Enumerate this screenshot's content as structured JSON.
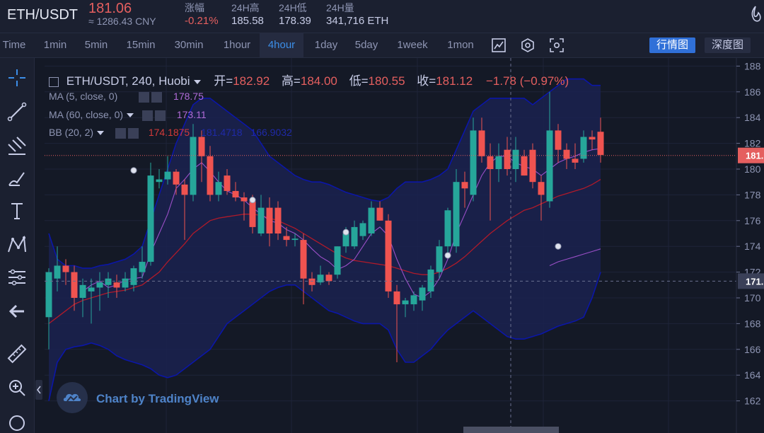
{
  "ticker": {
    "pair": "ETH/USDT",
    "price": "181.06",
    "cny": "≈ 1286.43 CNY",
    "change_label": "涨幅",
    "change_value": "-0.21%",
    "high_label": "24H高",
    "high_value": "185.58",
    "low_label": "24H低",
    "low_value": "178.39",
    "volume_label": "24H量",
    "volume_value": "341,716 ETH"
  },
  "toolbar": {
    "intervals": [
      "Time",
      "1min",
      "5min",
      "15min",
      "30min",
      "1hour",
      "4hour",
      "1day",
      "5day",
      "1week",
      "1mon"
    ],
    "active_interval": "4hour",
    "mode_buttons": [
      "行情图",
      "深度图"
    ],
    "active_mode": "行情图"
  },
  "legend": {
    "main": {
      "title": "ETH/USDT, 240, Huobi",
      "open_label": "开=",
      "open": "182.92",
      "high_label": "高=",
      "high": "184.00",
      "low_label": "低=",
      "low": "180.55",
      "close_label": "收=",
      "close": "181.12",
      "change": "−1.78 (−0.97%)"
    },
    "ma5": {
      "label": "MA (5, close, 0)",
      "value": "178.75",
      "color": "#b06bd8"
    },
    "ma60": {
      "label": "MA (60, close, 0)",
      "value": "173.11",
      "color": "#b06bd8"
    },
    "bb": {
      "label": "BB (20, 2)",
      "values": [
        "174.1875",
        "181.4718",
        "166.9032"
      ],
      "colors": [
        "#d23a3a",
        "#1f2aa8",
        "#1f2aa8"
      ]
    }
  },
  "watermark": {
    "text": "Chart by TradingView"
  },
  "colors": {
    "up": "#26a69a",
    "down": "#ef5350",
    "bg": "#141926",
    "band_fill": "#1a2250",
    "band_line": "#0b16a8",
    "mid_line": "#b01a2a",
    "ma_line": "#9a4fc7",
    "price_line": "#e55f5f"
  },
  "chart_data": {
    "type": "candlestick",
    "pair": "ETH/USDT",
    "interval": "240",
    "exchange": "Huobi",
    "ylim": [
      161,
      189
    ],
    "y_ticks": [
      162,
      164,
      166,
      168,
      170,
      172,
      174,
      176,
      178,
      180,
      182,
      184,
      186,
      188
    ],
    "last_price_tag": "181.",
    "crosshair_tag": "171.",
    "candles": [
      {
        "o": 168.5,
        "h": 172.3,
        "l": 166.0,
        "c": 172.0
      },
      {
        "o": 171.5,
        "h": 174.0,
        "l": 170.5,
        "c": 172.5
      },
      {
        "o": 172.5,
        "h": 173.0,
        "l": 171.0,
        "c": 172.0
      },
      {
        "o": 172.0,
        "h": 172.5,
        "l": 169.0,
        "c": 170.0
      },
      {
        "o": 170.0,
        "h": 171.5,
        "l": 168.5,
        "c": 171.0
      },
      {
        "o": 170.5,
        "h": 171.5,
        "l": 168.0,
        "c": 170.8
      },
      {
        "o": 170.8,
        "h": 172.0,
        "l": 169.0,
        "c": 171.2
      },
      {
        "o": 171.0,
        "h": 172.0,
        "l": 170.0,
        "c": 171.5
      },
      {
        "o": 171.2,
        "h": 171.8,
        "l": 170.0,
        "c": 170.8
      },
      {
        "o": 170.8,
        "h": 172.0,
        "l": 170.5,
        "c": 171.5
      },
      {
        "o": 171.0,
        "h": 172.5,
        "l": 170.5,
        "c": 172.3
      },
      {
        "o": 172.0,
        "h": 174.0,
        "l": 171.5,
        "c": 172.8
      },
      {
        "o": 172.8,
        "h": 180.5,
        "l": 172.5,
        "c": 179.5
      },
      {
        "o": 179.0,
        "h": 180.0,
        "l": 178.5,
        "c": 179.2
      },
      {
        "o": 179.2,
        "h": 181.0,
        "l": 178.8,
        "c": 179.8
      },
      {
        "o": 179.8,
        "h": 180.0,
        "l": 178.0,
        "c": 178.8
      },
      {
        "o": 178.8,
        "h": 179.2,
        "l": 174.5,
        "c": 178.0
      },
      {
        "o": 178.0,
        "h": 183.5,
        "l": 177.5,
        "c": 182.5
      },
      {
        "o": 182.5,
        "h": 183.0,
        "l": 179.0,
        "c": 181.0
      },
      {
        "o": 181.0,
        "h": 181.8,
        "l": 177.5,
        "c": 178.0
      },
      {
        "o": 178.0,
        "h": 179.8,
        "l": 177.5,
        "c": 179.0
      },
      {
        "o": 179.5,
        "h": 180.0,
        "l": 178.0,
        "c": 178.3
      },
      {
        "o": 178.3,
        "h": 179.0,
        "l": 177.5,
        "c": 177.8
      },
      {
        "o": 177.8,
        "h": 178.2,
        "l": 176.0,
        "c": 177.5
      },
      {
        "o": 177.5,
        "h": 178.0,
        "l": 175.0,
        "c": 175.5
      },
      {
        "o": 175.0,
        "h": 178.0,
        "l": 174.8,
        "c": 177.0
      },
      {
        "o": 177.0,
        "h": 177.8,
        "l": 174.0,
        "c": 175.0
      },
      {
        "o": 177.0,
        "h": 177.5,
        "l": 174.5,
        "c": 175.0
      },
      {
        "o": 174.8,
        "h": 175.5,
        "l": 174.0,
        "c": 174.5
      },
      {
        "o": 174.5,
        "h": 175.0,
        "l": 174.0,
        "c": 174.6
      },
      {
        "o": 174.5,
        "h": 175.0,
        "l": 169.5,
        "c": 171.5
      },
      {
        "o": 171.5,
        "h": 172.0,
        "l": 170.5,
        "c": 171.0
      },
      {
        "o": 171.2,
        "h": 172.5,
        "l": 171.0,
        "c": 171.8
      },
      {
        "o": 171.8,
        "h": 172.0,
        "l": 171.0,
        "c": 171.3
      },
      {
        "o": 171.8,
        "h": 174.0,
        "l": 171.5,
        "c": 174.0
      },
      {
        "o": 174.0,
        "h": 175.5,
        "l": 173.5,
        "c": 175.0
      },
      {
        "o": 174.0,
        "h": 176.0,
        "l": 173.8,
        "c": 175.5
      },
      {
        "o": 174.8,
        "h": 176.0,
        "l": 174.5,
        "c": 175.8
      },
      {
        "o": 175.0,
        "h": 177.5,
        "l": 174.8,
        "c": 177.0
      },
      {
        "o": 177.0,
        "h": 177.5,
        "l": 176.0,
        "c": 176.0
      },
      {
        "o": 176.0,
        "h": 176.5,
        "l": 170.0,
        "c": 170.5
      },
      {
        "o": 170.5,
        "h": 171.0,
        "l": 165.0,
        "c": 169.5
      },
      {
        "o": 169.5,
        "h": 170.0,
        "l": 168.5,
        "c": 169.8
      },
      {
        "o": 169.5,
        "h": 170.5,
        "l": 169.0,
        "c": 170.2
      },
      {
        "o": 169.8,
        "h": 171.0,
        "l": 169.0,
        "c": 170.8
      },
      {
        "o": 170.5,
        "h": 172.5,
        "l": 170.0,
        "c": 172.2
      },
      {
        "o": 172.0,
        "h": 174.5,
        "l": 171.5,
        "c": 174.0
      },
      {
        "o": 174.0,
        "h": 177.0,
        "l": 173.5,
        "c": 176.8
      },
      {
        "o": 174.0,
        "h": 180.0,
        "l": 173.5,
        "c": 179.0
      },
      {
        "o": 179.0,
        "h": 179.8,
        "l": 177.0,
        "c": 178.5
      },
      {
        "o": 178.0,
        "h": 184.0,
        "l": 177.5,
        "c": 183.0
      },
      {
        "o": 183.0,
        "h": 184.0,
        "l": 180.5,
        "c": 181.0
      },
      {
        "o": 181.0,
        "h": 182.0,
        "l": 176.0,
        "c": 180.0
      },
      {
        "o": 180.0,
        "h": 182.0,
        "l": 179.0,
        "c": 181.0
      },
      {
        "o": 181.5,
        "h": 182.5,
        "l": 179.5,
        "c": 180.0
      },
      {
        "o": 180.0,
        "h": 182.5,
        "l": 179.0,
        "c": 181.5
      },
      {
        "o": 181.0,
        "h": 181.5,
        "l": 179.5,
        "c": 179.5
      },
      {
        "o": 181.5,
        "h": 182.0,
        "l": 178.5,
        "c": 179.0
      },
      {
        "o": 179.0,
        "h": 179.5,
        "l": 176.0,
        "c": 178.0
      },
      {
        "o": 177.5,
        "h": 186.0,
        "l": 177.0,
        "c": 183.0
      },
      {
        "o": 183.0,
        "h": 183.5,
        "l": 180.5,
        "c": 181.5
      },
      {
        "o": 181.5,
        "h": 182.0,
        "l": 180.0,
        "c": 180.8
      },
      {
        "o": 180.8,
        "h": 182.0,
        "l": 180.0,
        "c": 180.5
      },
      {
        "o": 180.8,
        "h": 183.0,
        "l": 180.5,
        "c": 182.5
      },
      {
        "o": 182.5,
        "h": 183.0,
        "l": 181.5,
        "c": 182.3
      },
      {
        "o": 182.9,
        "h": 184.0,
        "l": 180.5,
        "c": 181.1
      }
    ],
    "ma5": [
      null,
      null,
      null,
      null,
      170.5,
      171.0,
      171.3,
      170.8,
      171.0,
      171.4,
      171.5,
      171.6,
      173.5,
      175.0,
      176.5,
      178.5,
      179.2,
      180.0,
      180.5,
      179.8,
      179.0,
      178.3,
      178.0,
      177.6,
      177.0,
      176.5,
      176.0,
      175.8,
      175.3,
      175.0,
      174.5,
      173.8,
      173.2,
      172.8,
      172.2,
      172.5,
      173.0,
      174.0,
      175.0,
      175.5,
      174.8,
      173.0,
      171.5,
      170.3,
      170.0,
      170.5,
      171.5,
      173.0,
      175.0,
      176.5,
      178.0,
      179.5,
      180.5,
      181.0,
      181.0,
      180.5,
      180.2,
      180.0,
      179.5,
      180.0,
      180.5,
      180.8,
      181.0,
      181.3,
      181.5,
      181.6
    ],
    "ma60": [
      null,
      null,
      null,
      null,
      null,
      null,
      null,
      null,
      null,
      null,
      null,
      null,
      null,
      null,
      null,
      null,
      null,
      null,
      null,
      null,
      null,
      null,
      null,
      null,
      null,
      null,
      null,
      null,
      null,
      null,
      null,
      null,
      null,
      null,
      null,
      null,
      null,
      null,
      null,
      null,
      null,
      null,
      null,
      null,
      null,
      null,
      null,
      null,
      null,
      null,
      null,
      null,
      null,
      null,
      null,
      null,
      null,
      null,
      null,
      172.5,
      172.8,
      173.0,
      173.2,
      173.4,
      173.6,
      173.8
    ],
    "bb_mid": [
      168.0,
      168.5,
      169.0,
      169.5,
      169.8,
      170.0,
      170.2,
      170.4,
      170.5,
      170.6,
      170.8,
      171.0,
      171.5,
      172.0,
      172.8,
      173.5,
      174.2,
      175.0,
      175.5,
      176.0,
      176.2,
      176.3,
      176.4,
      176.5,
      176.5,
      176.4,
      176.2,
      176.0,
      175.7,
      175.4,
      175.0,
      174.6,
      174.2,
      173.8,
      173.4,
      173.1,
      172.9,
      172.8,
      172.7,
      172.6,
      172.5,
      172.3,
      172.1,
      171.9,
      171.8,
      171.8,
      172.0,
      172.3,
      172.7,
      173.2,
      173.8,
      174.4,
      175.0,
      175.5,
      176.0,
      176.4,
      176.8,
      177.0,
      177.3,
      177.6,
      177.9,
      178.1,
      178.3,
      178.5,
      178.8,
      179.2
    ],
    "bb_upper": [
      175.0,
      173.0,
      172.5,
      172.5,
      172.3,
      172.3,
      172.5,
      172.6,
      172.8,
      173.0,
      173.4,
      174.0,
      176.0,
      178.0,
      180.0,
      182.0,
      183.5,
      185.0,
      185.5,
      185.5,
      185.0,
      184.5,
      184.0,
      183.5,
      183.0,
      182.0,
      181.0,
      180.5,
      180.0,
      179.5,
      179.2,
      179.0,
      179.0,
      178.8,
      178.5,
      178.2,
      178.0,
      177.8,
      177.6,
      177.5,
      177.8,
      178.5,
      179.0,
      179.0,
      179.0,
      179.2,
      179.5,
      180.0,
      181.5,
      183.0,
      184.5,
      185.0,
      185.5,
      185.5,
      185.5,
      185.5,
      185.5,
      185.0,
      185.5,
      186.0,
      186.5,
      187.0,
      187.0,
      187.0,
      186.5,
      186.5
    ],
    "bb_lower": [
      162.0,
      165.0,
      166.0,
      166.2,
      166.3,
      166.5,
      166.3,
      166.0,
      165.5,
      165.2,
      165.0,
      164.8,
      164.5,
      164.0,
      163.8,
      164.0,
      164.5,
      165.0,
      165.5,
      166.0,
      167.0,
      168.0,
      168.5,
      169.0,
      169.5,
      170.0,
      170.5,
      170.8,
      171.0,
      171.0,
      170.5,
      170.0,
      169.5,
      169.0,
      168.8,
      168.5,
      168.2,
      168.0,
      168.0,
      168.0,
      167.5,
      166.0,
      165.0,
      165.0,
      165.5,
      166.0,
      166.8,
      167.5,
      168.0,
      168.5,
      169.0,
      168.5,
      168.0,
      167.5,
      167.0,
      166.8,
      166.8,
      167.0,
      167.2,
      167.5,
      167.8,
      168.0,
      168.2,
      168.5,
      170.0,
      172.0
    ]
  }
}
